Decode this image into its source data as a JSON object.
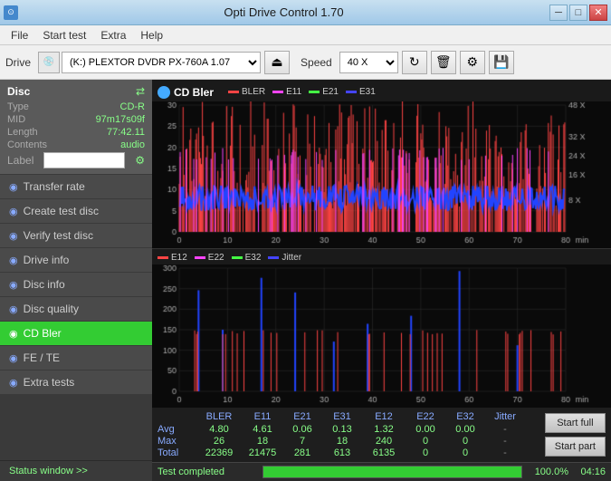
{
  "titlebar": {
    "title": "Opti Drive Control 1.70",
    "icon": "⊙",
    "btn_minimize": "─",
    "btn_restore": "□",
    "btn_close": "✕"
  },
  "menubar": {
    "items": [
      "File",
      "Start test",
      "Extra",
      "Help"
    ]
  },
  "toolbar": {
    "drive_label": "Drive",
    "drive_icon": "💿",
    "drive_value": "(K:)  PLEXTOR DVDR  PX-760A 1.07",
    "speed_label": "Speed",
    "speed_value": "40 X"
  },
  "sidebar": {
    "disc_title": "Disc",
    "disc_fields": [
      {
        "label": "Type",
        "value": "CD-R"
      },
      {
        "label": "MID",
        "value": "97m17s09f"
      },
      {
        "label": "Length",
        "value": "77:42.11"
      },
      {
        "label": "Contents",
        "value": "audio"
      },
      {
        "label": "Label",
        "value": ""
      }
    ],
    "items": [
      {
        "label": "Transfer rate",
        "icon": "◉"
      },
      {
        "label": "Create test disc",
        "icon": "◉"
      },
      {
        "label": "Verify test disc",
        "icon": "◉"
      },
      {
        "label": "Drive info",
        "icon": "◉"
      },
      {
        "label": "Disc info",
        "icon": "◉"
      },
      {
        "label": "Disc quality",
        "icon": "◉"
      },
      {
        "label": "CD Bler",
        "icon": "◉",
        "active": true
      },
      {
        "label": "FE / TE",
        "icon": "◉"
      },
      {
        "label": "Extra tests",
        "icon": "◉"
      }
    ],
    "status_window": "Status window >>"
  },
  "chart1": {
    "title": "CD Bler",
    "legend": [
      {
        "label": "BLER",
        "color": "#ff4444"
      },
      {
        "label": "E11",
        "color": "#ff44ff"
      },
      {
        "label": "E21",
        "color": "#44ff44"
      },
      {
        "label": "E31",
        "color": "#4444ff"
      }
    ],
    "y_max": 30,
    "y_labels": [
      "30",
      "25",
      "20",
      "15",
      "10",
      "5",
      "0"
    ],
    "x_labels": [
      "0",
      "10",
      "20",
      "30",
      "40",
      "50",
      "60",
      "70",
      "80 min"
    ],
    "right_labels": [
      "48 X",
      "32 X",
      "24 X",
      "16 X",
      "8 X"
    ]
  },
  "chart2": {
    "legend": [
      {
        "label": "E12",
        "color": "#ff4444"
      },
      {
        "label": "E22",
        "color": "#ff44ff"
      },
      {
        "label": "E32",
        "color": "#44ff44"
      },
      {
        "label": "Jitter",
        "color": "#4444ff"
      }
    ],
    "y_max": 300,
    "y_labels": [
      "300",
      "250",
      "200",
      "150",
      "100",
      "50",
      "0"
    ],
    "x_labels": [
      "0",
      "10",
      "20",
      "30",
      "40",
      "50",
      "60",
      "70",
      "80 min"
    ]
  },
  "data_table": {
    "columns": [
      "",
      "BLER",
      "E11",
      "E21",
      "E31",
      "E12",
      "E22",
      "E32",
      "Jitter"
    ],
    "rows": [
      {
        "label": "Avg",
        "values": [
          "4.80",
          "4.61",
          "0.06",
          "0.13",
          "1.32",
          "0.00",
          "0.00",
          "-"
        ]
      },
      {
        "label": "Max",
        "values": [
          "26",
          "18",
          "7",
          "18",
          "240",
          "0",
          "0",
          "-"
        ]
      },
      {
        "label": "Total",
        "values": [
          "22369",
          "21475",
          "281",
          "613",
          "6135",
          "0",
          "0",
          "-"
        ]
      }
    ]
  },
  "buttons": {
    "start_full": "Start full",
    "start_part": "Start part"
  },
  "statusbar": {
    "text": "Test completed",
    "progress": 100.0,
    "progress_text": "100.0%",
    "time": "04:16"
  }
}
